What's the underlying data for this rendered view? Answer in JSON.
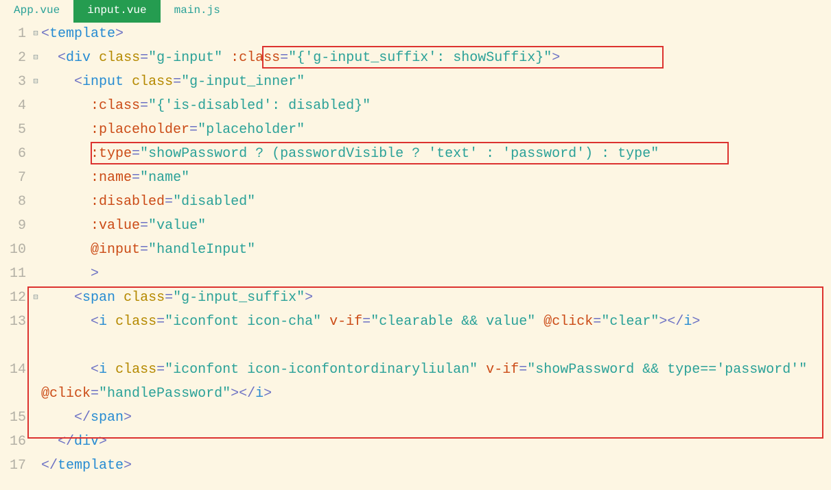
{
  "tabs": [
    {
      "label": "App.vue",
      "active": false
    },
    {
      "label": "input.vue",
      "active": true
    },
    {
      "label": "main.js",
      "active": false
    }
  ],
  "gutter": [
    "1",
    "2",
    "3",
    "4",
    "5",
    "6",
    "7",
    "8",
    "9",
    "10",
    "11",
    "12",
    "13",
    "14",
    "15",
    "16",
    "17"
  ],
  "fold": [
    "⊟",
    "⊟",
    "⊟",
    "",
    "",
    "",
    "",
    "",
    "",
    "",
    "",
    "⊟",
    "",
    "",
    "",
    "",
    ""
  ],
  "code": {
    "l1": {
      "p1": "<",
      "tag": "template",
      "p2": ">"
    },
    "l2": {
      "ind": "  ",
      "p1": "<",
      "tag": "div",
      "sp": " ",
      "a1": "class",
      "eq": "=",
      "v1": "\"g-input\"",
      "sp2": " ",
      "b1": ":class",
      "eq2": "=",
      "bv1s": "\"",
      "bv1a": "{'g-input_suffix': showSuffix}",
      "bv1e": "\"",
      "p2": ">"
    },
    "l3": {
      "ind": "    ",
      "p1": "<",
      "tag": "input",
      "sp": " ",
      "a1": "class",
      "eq": "=",
      "v1": "\"g-input_inner\""
    },
    "l4": {
      "ind": "      ",
      "b": ":class",
      "eq": "=",
      "s": "\"",
      "av": "{'is-disabled': disabled}",
      "e": "\""
    },
    "l5": {
      "ind": "      ",
      "b": ":placeholder",
      "eq": "=",
      "s": "\"",
      "av": "placeholder",
      "e": "\""
    },
    "l6": {
      "ind": "      ",
      "b": ":type",
      "eq": "=",
      "s": "\"",
      "av": "showPassword ? (passwordVisible ? 'text' : 'password') : type",
      "e": "\""
    },
    "l7": {
      "ind": "      ",
      "b": ":name",
      "eq": "=",
      "s": "\"",
      "av": "name",
      "e": "\""
    },
    "l8": {
      "ind": "      ",
      "b": ":disabled",
      "eq": "=",
      "s": "\"",
      "av": "disabled",
      "e": "\""
    },
    "l9": {
      "ind": "      ",
      "b": ":value",
      "eq": "=",
      "s": "\"",
      "av": "value",
      "e": "\""
    },
    "l10": {
      "ind": "      ",
      "b": "@input",
      "eq": "=",
      "s": "\"",
      "av": "handleInput",
      "e": "\""
    },
    "l11": {
      "ind": "      ",
      "p": ">"
    },
    "l12": {
      "ind": "    ",
      "p1": "<",
      "tag": "span",
      "sp": " ",
      "a": "class",
      "eq": "=",
      "v": "\"g-input_suffix\"",
      "p2": ">"
    },
    "l13": {
      "ind": "      ",
      "p1": "<",
      "tag": "i",
      "sp": " ",
      "a1": "class",
      "eq1": "=",
      "v1": "\"iconfont icon-cha\"",
      "sp2": " ",
      "b1": "v-if",
      "eq2": "=",
      "s1": "\"",
      "av1": "clearable && value",
      "e1": "\"",
      "sp3": " ",
      "b2": "@click",
      "eq3": "=",
      "s2": "\"",
      "av2": "clear",
      "e2": "\"",
      "p2": ">",
      "p3": "</",
      "tag2": "i",
      "p4": ">"
    },
    "l14": {
      "ind": "      ",
      "p1": "<",
      "tag": "i",
      "sp": " ",
      "a1": "class",
      "eq1": "=",
      "v1": "\"iconfont icon-iconfontordinaryliulan\"",
      "sp2": " ",
      "b1": "v-if",
      "eq2": "=",
      "s1": "\"",
      "av1": "showPassword && type=='password'",
      "e1": "\"",
      "sp3": " ",
      "b2": "@click",
      "eq3": "=",
      "s2": "\"",
      "av2": "handlePassword",
      "e2": "\"",
      "p2": ">",
      "p3": "</",
      "tag2": "i",
      "p4": ">"
    },
    "l15": {
      "ind": "    ",
      "p1": "</",
      "tag": "span",
      "p2": ">"
    },
    "l16": {
      "ind": "  ",
      "p1": "</",
      "tag": "div",
      "p2": ">"
    },
    "l17": {
      "p1": "</",
      "tag": "template",
      "p2": ">"
    }
  }
}
